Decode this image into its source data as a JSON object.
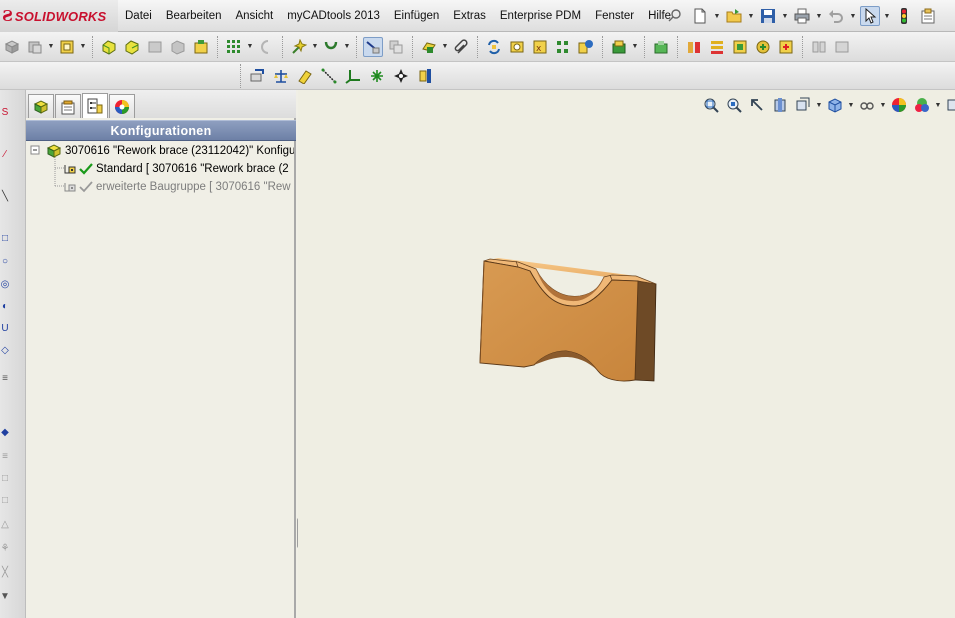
{
  "app": {
    "logo_ds": "Ƨ",
    "logo_text": "SOLIDWORKS",
    "brand_color": "#c8102e"
  },
  "menu": {
    "items": [
      "Datei",
      "Bearbeiten",
      "Ansicht",
      "myCADtools 2013",
      "Einfügen",
      "Extras",
      "Enterprise PDM",
      "Fenster",
      "Hilfe"
    ]
  },
  "panel": {
    "tabs": [
      "featuremanager-icon",
      "propertymanager-icon",
      "configurationmanager-icon",
      "displaymanager-icon"
    ],
    "active_tab": 2,
    "header": "Konfigurationen",
    "header_color": "#7b8db2",
    "tree": {
      "root": "3070616 \"Rework brace (23112042)\" Konfigu",
      "children": [
        {
          "label": "Standard [ 3070616 \"Rework brace (2",
          "active": true
        },
        {
          "label": "erweiterte Baugruppe [ 3070616 \"Rew",
          "active": false
        }
      ]
    }
  },
  "model": {
    "face_color": "#e0a055",
    "shadow_color": "#6e4a26"
  }
}
